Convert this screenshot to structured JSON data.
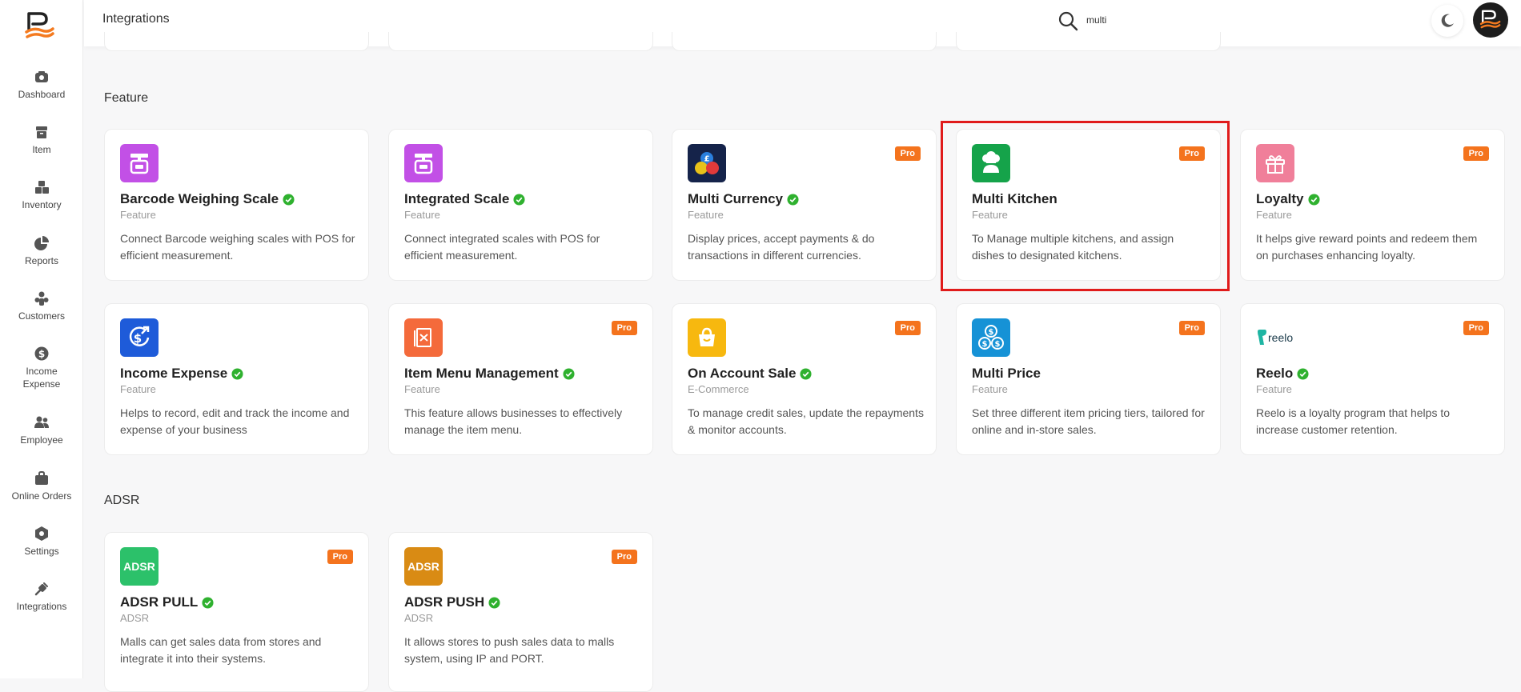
{
  "header": {
    "title": "Integrations",
    "search_value": "multi"
  },
  "sidebar": {
    "items": [
      {
        "label": "Dashboard",
        "icon": "camera-icon"
      },
      {
        "label": "Item",
        "icon": "box-icon"
      },
      {
        "label": "Inventory",
        "icon": "boxes-icon"
      },
      {
        "label": "Reports",
        "icon": "pie-chart-icon"
      },
      {
        "label": "Customers",
        "icon": "users-icon"
      },
      {
        "label": "Income",
        "label2": "Expense",
        "icon": "dollar-icon"
      },
      {
        "label": "Employee",
        "icon": "employee-icon"
      },
      {
        "label": "Online Orders",
        "icon": "bag-icon"
      },
      {
        "label": "Settings",
        "icon": "gear-icon"
      },
      {
        "label": "Integrations",
        "icon": "plug-icon"
      }
    ]
  },
  "sections": {
    "feature": "Feature",
    "adsr": "ADSR"
  },
  "pro_label": "Pro",
  "cards": [
    {
      "title": "Barcode Weighing Scale",
      "subtitle": "Feature",
      "desc": "Connect Barcode weighing scales with POS for efficient measurement.",
      "icon": "scale-icon",
      "color": "#c250e6"
    },
    {
      "title": "Integrated Scale",
      "subtitle": "Feature",
      "desc": "Connect integrated scales with POS for efficient measurement.",
      "icon": "scale-icon",
      "color": "#c250e6"
    },
    {
      "title": "Multi Currency",
      "subtitle": "Feature",
      "desc": "Display prices, accept payments & do transactions in different currencies.",
      "icon": "currency-icon",
      "color": "#15234a"
    },
    {
      "title": "Multi Kitchen",
      "subtitle": "Feature",
      "desc": "To Manage multiple kitchens, and assign dishes to designated kitchens.",
      "icon": "chef-icon",
      "color": "#15a34a"
    },
    {
      "title": "Loyalty",
      "subtitle": "Feature",
      "desc": "It helps give reward points and redeem them on purchases enhancing loyalty.",
      "icon": "gift-icon",
      "color": "#f07f9a"
    },
    {
      "title": "Income Expense",
      "subtitle": "Feature",
      "desc": "Helps to record, edit and track the income and expense of your business",
      "icon": "income-expense-icon",
      "color": "#1e5bd9"
    },
    {
      "title": "Item Menu Management",
      "subtitle": "Feature",
      "desc": "This feature allows businesses to effectively manage the item menu.",
      "icon": "menu-icon",
      "color": "#f46a3b"
    },
    {
      "title": "On Account Sale",
      "subtitle": "E-Commerce",
      "desc": "To manage credit sales, update the repayments & monitor accounts.",
      "icon": "shopping-bag-icon",
      "color": "#f7b80f"
    },
    {
      "title": "Multi Price",
      "subtitle": "Feature",
      "desc": "Set three different item pricing tiers, tailored for online and in-store sales.",
      "icon": "coins-icon",
      "color": "#1692d6"
    },
    {
      "title": "Reelo",
      "subtitle": "Feature",
      "desc": "Reelo is a loyalty program that helps to increase customer retention.",
      "icon": "reelo-logo-icon",
      "logo_text": "reelo",
      "color": "#1fb5a3"
    },
    {
      "title": "ADSR PULL",
      "subtitle": "ADSR",
      "desc": "Malls can get sales data from stores and integrate it into their systems.",
      "icon": "adsr-icon",
      "icon_text": "ADSR",
      "color": "#2cc16a"
    },
    {
      "title": "ADSR PUSH",
      "subtitle": "ADSR",
      "desc": "It allows stores to push sales data to malls system, using IP and PORT.",
      "icon": "adsr-icon",
      "icon_text": "ADSR",
      "color": "#d98b14"
    }
  ]
}
